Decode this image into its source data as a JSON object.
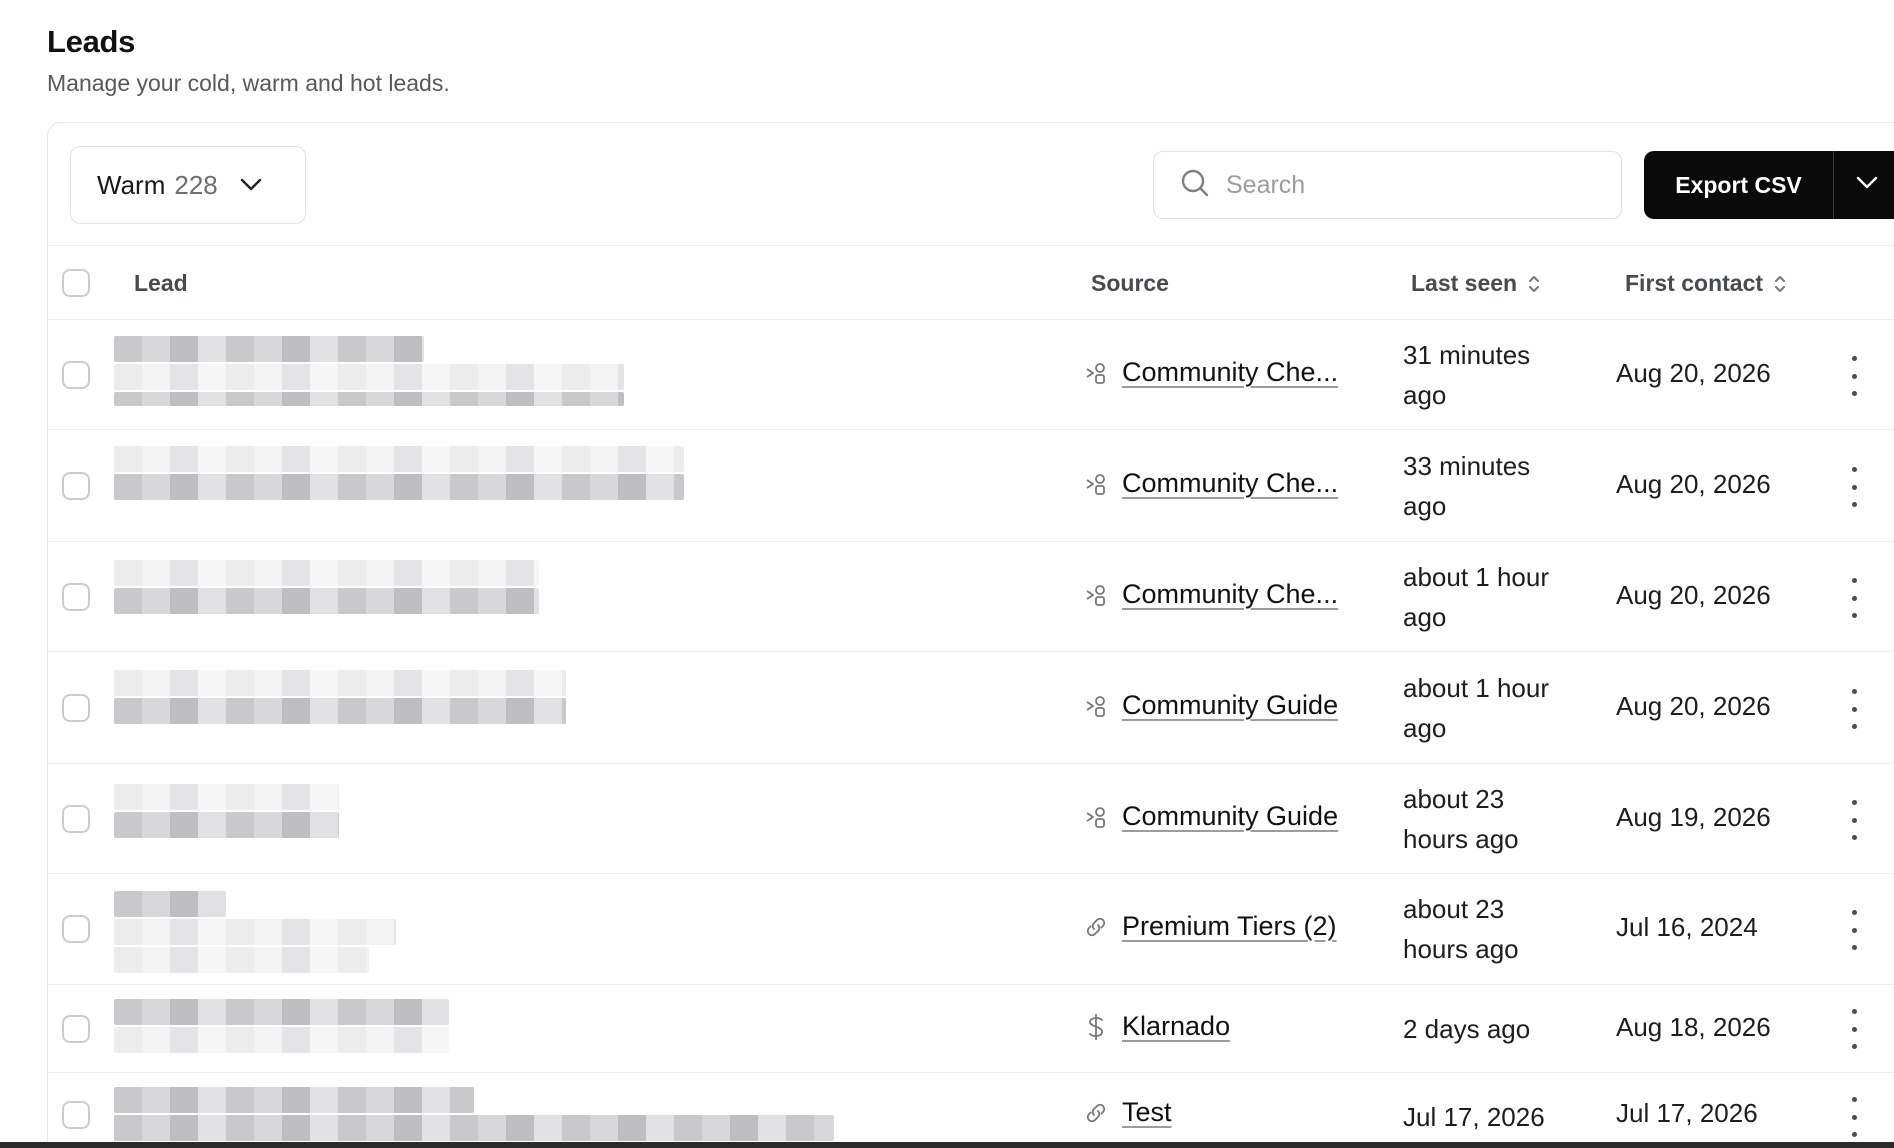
{
  "page": {
    "title": "Leads",
    "subtitle": "Manage your cold, warm and hot leads."
  },
  "toolbar": {
    "filter_label": "Warm",
    "filter_count": "228",
    "search_placeholder": "Search",
    "export_label": "Export CSV"
  },
  "table": {
    "columns": {
      "lead": "Lead",
      "source": "Source",
      "last_seen": "Last seen",
      "first_contact": "First contact"
    },
    "rows": [
      {
        "source_icon": "share-node-icon",
        "source": "Community Che...",
        "last_seen": "31 minutes ago",
        "first_contact": "Aug 20, 2026"
      },
      {
        "source_icon": "share-node-icon",
        "source": "Community Che...",
        "last_seen": "33 minutes ago",
        "first_contact": "Aug 20, 2026"
      },
      {
        "source_icon": "share-node-icon",
        "source": "Community Che...",
        "last_seen": "about 1 hour ago",
        "first_contact": "Aug 20, 2026"
      },
      {
        "source_icon": "share-node-icon",
        "source": "Community Guide",
        "last_seen": "about 1 hour ago",
        "first_contact": "Aug 20, 2026"
      },
      {
        "source_icon": "share-node-icon",
        "source": "Community Guide",
        "last_seen": "about 23 hours ago",
        "first_contact": "Aug 19, 2026"
      },
      {
        "source_icon": "link-icon",
        "source": "Premium Tiers (2)",
        "last_seen": "about 23 hours ago",
        "first_contact": "Jul 16, 2024"
      },
      {
        "source_icon": "dollar-icon",
        "source": "Klarnado",
        "last_seen": "2 days ago",
        "first_contact": "Aug 18, 2026"
      },
      {
        "source_icon": "link-icon",
        "source": "Test",
        "last_seen": "Jul 17, 2026",
        "first_contact": "Jul 17, 2026"
      }
    ]
  },
  "colors": {
    "accent_button": "#0a0a0a",
    "border": "#dfe0e3",
    "muted_text": "#55585e"
  }
}
